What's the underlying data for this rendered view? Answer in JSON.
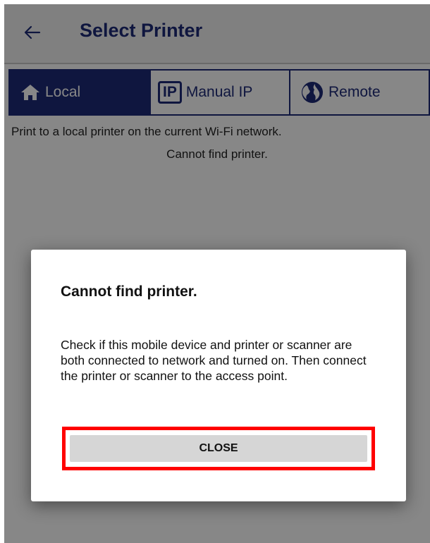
{
  "app_bar": {
    "title": "Select Printer",
    "back_icon": "arrow-left-icon"
  },
  "tabs": [
    {
      "label": "Local",
      "icon": "home-icon",
      "active": true
    },
    {
      "label": "Manual IP",
      "icon_text": "IP",
      "active": false
    },
    {
      "label": "Remote",
      "icon": "globe-icon",
      "active": false
    }
  ],
  "main": {
    "description": "Print to a local printer on the current Wi-Fi network.",
    "status": "Cannot find printer."
  },
  "dialog": {
    "title": "Cannot find printer.",
    "message": "Check if this mobile device and printer or scanner are both connected to network and turned on. Then connect the printer or scanner to the access point.",
    "close_label": "CLOSE"
  },
  "colors": {
    "accent": "#1e2a78",
    "highlight": "#ff0000",
    "button_bg": "#d6d6d6"
  }
}
